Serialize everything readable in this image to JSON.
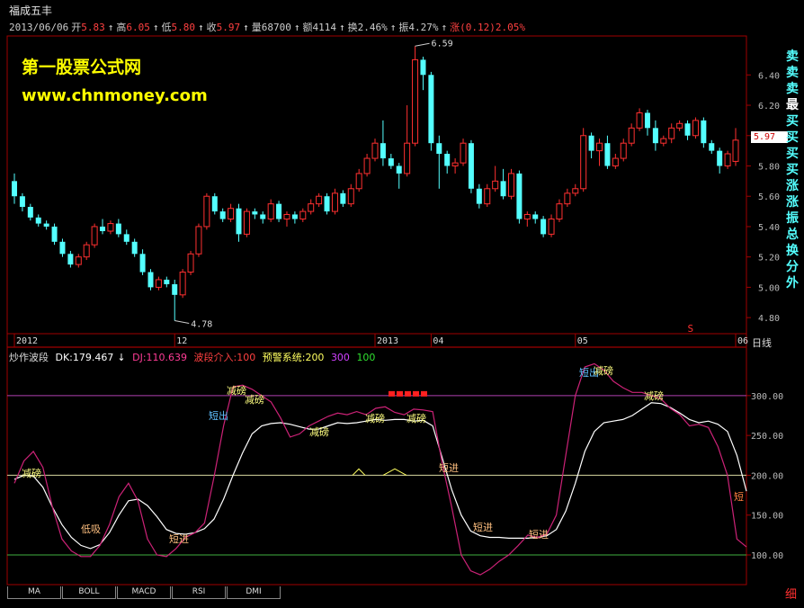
{
  "window": {
    "title": "福成五丰"
  },
  "quote": {
    "date": "2013/06/06",
    "open_label": "开",
    "open": "5.83",
    "high_label": "高",
    "high": "6.05",
    "low_label": "低",
    "low": "5.80",
    "close_label": "收",
    "close": "5.97",
    "vol_label": "量",
    "vol": "68700",
    "amt_label": "额",
    "amt": "4114",
    "turn_label": "换",
    "turn": "2.46%",
    "amp_label": "振",
    "amp": "4.27%",
    "chg_label": "涨",
    "chg": "(0.12)2.05%"
  },
  "watermark": {
    "line1": "第一股票公式网",
    "line2": "www.chnmoney.com"
  },
  "price_axis": {
    "ticks": [
      "6.40",
      "6.20",
      "6.00",
      "5.80",
      "5.60",
      "5.40",
      "5.20",
      "5.00",
      "4.80"
    ],
    "current": "5.97"
  },
  "price_markers": {
    "high": "6.59",
    "low": "4.78"
  },
  "time_axis": {
    "labels": [
      "2012",
      "12",
      "2013",
      "04",
      "05",
      "06"
    ],
    "period": "日线"
  },
  "ind_header": {
    "name": "炒作波段",
    "dk": "DK:179.467",
    "dj": "DJ:110.639",
    "band": "波段介入:100",
    "warn": "预警系统:200",
    "l300": "300",
    "l100": "100"
  },
  "ind_axis": {
    "ticks": [
      "300.00",
      "250.00",
      "200.00",
      "150.00",
      "100.00"
    ]
  },
  "annotations": {
    "reduce": "减磅",
    "low_buy": "低吸",
    "short_in": "短进",
    "short_out": "短出",
    "s_mark": "S",
    "right_edge": "短"
  },
  "right_column": [
    "卖",
    "卖",
    "卖",
    "最",
    "买",
    "买",
    "买",
    "买",
    "涨",
    "涨",
    "振",
    "总",
    "换",
    "分",
    "外"
  ],
  "bottom_tabs": [
    "MA",
    "BOLL",
    "MACD",
    "RSI",
    "DMI"
  ],
  "corner": "细",
  "colors": {
    "up": "#ff3030",
    "down": "#54ffff",
    "dk": "#ffffff",
    "dj": "#cc2277",
    "grid": "#a00000"
  },
  "chart_data": [
    {
      "type": "candlestick",
      "title": "福成五丰 日线",
      "ylim": [
        4.7,
        6.55
      ],
      "candles": [
        [
          5.7,
          5.6,
          5.75,
          5.55
        ],
        [
          5.6,
          5.53,
          5.62,
          5.5
        ],
        [
          5.53,
          5.46,
          5.55,
          5.44
        ],
        [
          5.46,
          5.42,
          5.48,
          5.4
        ],
        [
          5.42,
          5.4,
          5.44,
          5.38
        ],
        [
          5.4,
          5.3,
          5.42,
          5.28
        ],
        [
          5.3,
          5.22,
          5.32,
          5.2
        ],
        [
          5.22,
          5.15,
          5.24,
          5.13
        ],
        [
          5.15,
          5.2,
          5.22,
          5.13
        ],
        [
          5.2,
          5.28,
          5.3,
          5.18
        ],
        [
          5.28,
          5.4,
          5.42,
          5.26
        ],
        [
          5.4,
          5.37,
          5.45,
          5.35
        ],
        [
          5.37,
          5.42,
          5.44,
          5.35
        ],
        [
          5.42,
          5.35,
          5.45,
          5.33
        ],
        [
          5.35,
          5.3,
          5.38,
          5.28
        ],
        [
          5.3,
          5.22,
          5.32,
          5.2
        ],
        [
          5.22,
          5.1,
          5.25,
          5.08
        ],
        [
          5.1,
          5.0,
          5.12,
          4.98
        ],
        [
          5.0,
          5.05,
          5.07,
          4.98
        ],
        [
          5.05,
          5.02,
          5.07,
          5.0
        ],
        [
          5.02,
          4.95,
          5.05,
          4.78
        ],
        [
          4.95,
          5.1,
          5.12,
          4.93
        ],
        [
          5.1,
          5.22,
          5.24,
          5.08
        ],
        [
          5.22,
          5.4,
          5.42,
          5.2
        ],
        [
          5.4,
          5.6,
          5.62,
          5.38
        ],
        [
          5.6,
          5.5,
          5.62,
          5.48
        ],
        [
          5.5,
          5.45,
          5.52,
          5.43
        ],
        [
          5.45,
          5.52,
          5.55,
          5.43
        ],
        [
          5.52,
          5.35,
          5.55,
          5.3
        ],
        [
          5.35,
          5.5,
          5.52,
          5.33
        ],
        [
          5.5,
          5.48,
          5.52,
          5.45
        ],
        [
          5.48,
          5.45,
          5.5,
          5.42
        ],
        [
          5.45,
          5.55,
          5.58,
          5.43
        ],
        [
          5.55,
          5.45,
          5.57,
          5.43
        ],
        [
          5.45,
          5.48,
          5.5,
          5.4
        ],
        [
          5.48,
          5.45,
          5.5,
          5.42
        ],
        [
          5.45,
          5.5,
          5.52,
          5.43
        ],
        [
          5.5,
          5.55,
          5.58,
          5.48
        ],
        [
          5.55,
          5.6,
          5.62,
          5.53
        ],
        [
          5.6,
          5.5,
          5.62,
          5.48
        ],
        [
          5.5,
          5.62,
          5.65,
          5.48
        ],
        [
          5.62,
          5.55,
          5.64,
          5.53
        ],
        [
          5.55,
          5.65,
          5.68,
          5.53
        ],
        [
          5.65,
          5.75,
          5.78,
          5.63
        ],
        [
          5.75,
          5.85,
          5.88,
          5.73
        ],
        [
          5.85,
          5.95,
          5.98,
          5.83
        ],
        [
          5.95,
          5.85,
          6.1,
          5.8
        ],
        [
          5.85,
          5.8,
          5.88,
          5.78
        ],
        [
          5.8,
          5.75,
          5.82,
          5.65
        ],
        [
          5.75,
          5.95,
          6.2,
          5.73
        ],
        [
          5.95,
          6.5,
          6.59,
          5.93
        ],
        [
          6.5,
          6.4,
          6.52,
          6.3
        ],
        [
          6.4,
          5.95,
          6.42,
          5.9
        ],
        [
          5.95,
          5.88,
          6.0,
          5.65
        ],
        [
          5.88,
          5.8,
          5.9,
          5.75
        ],
        [
          5.8,
          5.82,
          5.85,
          5.75
        ],
        [
          5.82,
          5.95,
          5.98,
          5.8
        ],
        [
          5.95,
          5.65,
          5.97,
          5.62
        ],
        [
          5.65,
          5.55,
          5.68,
          5.52
        ],
        [
          5.55,
          5.65,
          5.68,
          5.53
        ],
        [
          5.65,
          5.7,
          5.8,
          5.63
        ],
        [
          5.7,
          5.6,
          5.78,
          5.58
        ],
        [
          5.6,
          5.75,
          5.78,
          5.58
        ],
        [
          5.75,
          5.45,
          5.77,
          5.42
        ],
        [
          5.45,
          5.48,
          5.5,
          5.4
        ],
        [
          5.48,
          5.45,
          5.5,
          5.42
        ],
        [
          5.45,
          5.35,
          5.47,
          5.33
        ],
        [
          5.35,
          5.45,
          5.48,
          5.33
        ],
        [
          5.45,
          5.55,
          5.58,
          5.43
        ],
        [
          5.55,
          5.62,
          5.65,
          5.53
        ],
        [
          5.62,
          5.65,
          5.68,
          5.6
        ],
        [
          5.65,
          6.0,
          6.05,
          5.63
        ],
        [
          6.0,
          5.9,
          6.02,
          5.85
        ],
        [
          5.9,
          5.95,
          5.98,
          5.8
        ],
        [
          5.95,
          5.8,
          6.0,
          5.78
        ],
        [
          5.8,
          5.85,
          5.88,
          5.78
        ],
        [
          5.85,
          5.95,
          5.98,
          5.83
        ],
        [
          5.95,
          6.05,
          6.08,
          5.93
        ],
        [
          6.05,
          6.15,
          6.18,
          6.03
        ],
        [
          6.15,
          6.05,
          6.17,
          6.0
        ],
        [
          6.05,
          5.95,
          6.1,
          5.9
        ],
        [
          5.95,
          5.98,
          6.0,
          5.93
        ],
        [
          5.98,
          6.05,
          6.08,
          5.95
        ],
        [
          6.05,
          6.08,
          6.1,
          6.03
        ],
        [
          6.08,
          6.0,
          6.1,
          5.97
        ],
        [
          6.0,
          6.1,
          6.12,
          5.98
        ],
        [
          6.1,
          5.95,
          6.12,
          5.92
        ],
        [
          5.95,
          5.9,
          5.97,
          5.88
        ],
        [
          5.9,
          5.8,
          5.92,
          5.75
        ],
        [
          5.8,
          5.88,
          5.9,
          5.78
        ],
        [
          5.83,
          5.97,
          6.05,
          5.8
        ]
      ]
    },
    {
      "type": "line",
      "title": "炒作波段",
      "ylim": [
        65,
        345
      ],
      "series": [
        {
          "name": "DK",
          "values": [
            195,
            200,
            199,
            185,
            160,
            138,
            122,
            112,
            108,
            113,
            128,
            150,
            168,
            170,
            162,
            148,
            132,
            127,
            126,
            128,
            133,
            145,
            170,
            200,
            228,
            252,
            262,
            265,
            266,
            264,
            261,
            258,
            258,
            262,
            266,
            265,
            266,
            268,
            270,
            269,
            270,
            270,
            268,
            269,
            262,
            222,
            182,
            150,
            130,
            124,
            122,
            122,
            121,
            121,
            121,
            122,
            124,
            132,
            155,
            190,
            230,
            255,
            266,
            268,
            270,
            275,
            283,
            291,
            290,
            285,
            278,
            270,
            266,
            268,
            264,
            255,
            225,
            180
          ]
        },
        {
          "name": "DJ",
          "values": [
            190,
            218,
            230,
            210,
            160,
            120,
            105,
            98,
            98,
            112,
            138,
            173,
            190,
            168,
            120,
            100,
            98,
            108,
            122,
            128,
            140,
            198,
            262,
            311,
            313,
            308,
            300,
            292,
            272,
            248,
            252,
            262,
            268,
            274,
            278,
            276,
            280,
            276,
            284,
            286,
            279,
            276,
            283,
            282,
            280,
            215,
            160,
            100,
            80,
            75,
            82,
            92,
            100,
            112,
            125,
            122,
            126,
            150,
            225,
            300,
            336,
            340,
            332,
            318,
            310,
            304,
            304,
            300,
            296,
            284,
            276,
            262,
            264,
            260,
            236,
            200,
            120,
            110
          ]
        }
      ],
      "reference_lines": [
        300,
        200,
        100
      ]
    }
  ]
}
